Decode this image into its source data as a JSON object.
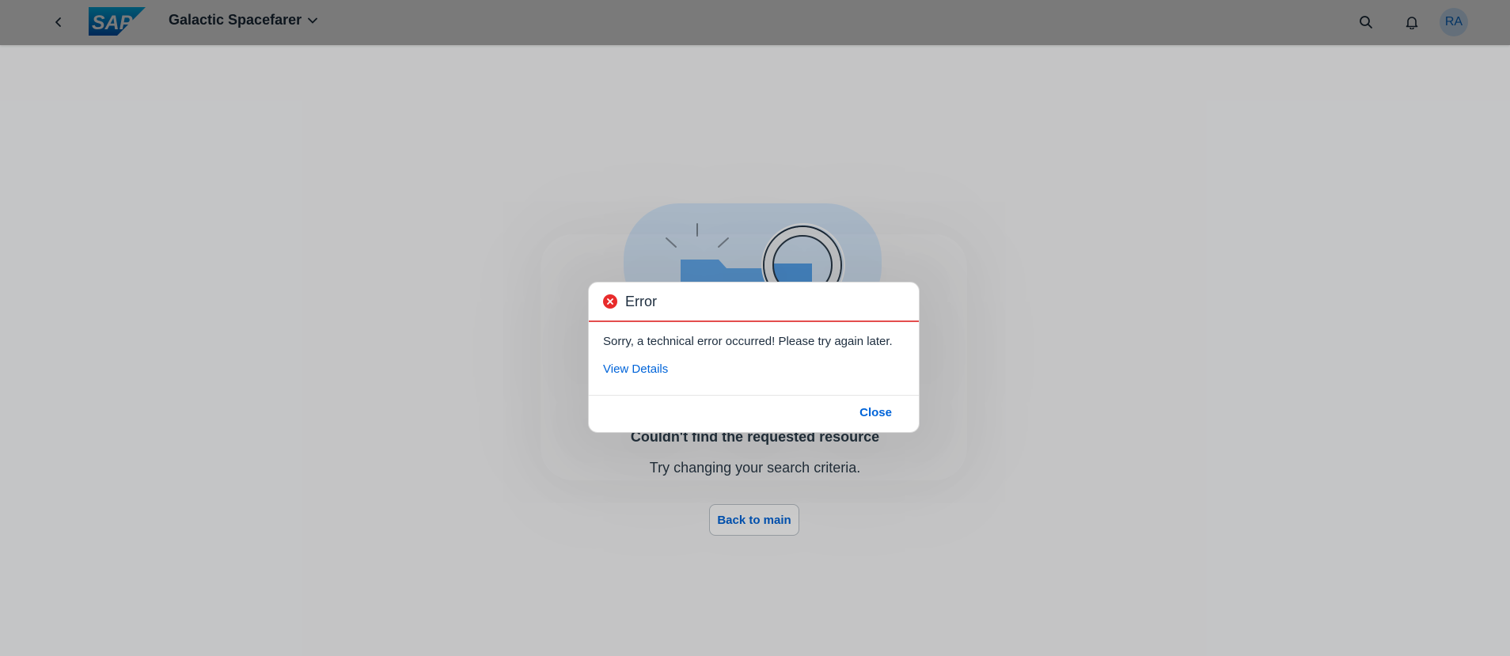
{
  "shell": {
    "logo_text": "SAP",
    "app_title": "Galactic Spacefarer",
    "avatar_initials": "RA",
    "icons": [
      "back-icon",
      "chevron-down-icon",
      "search-icon",
      "bell-icon"
    ]
  },
  "page": {
    "illustration": "folder-search-illustration",
    "title": "Couldn't find the requested resource",
    "subtitle": "Try changing your search criteria.",
    "back_button": "Back to main"
  },
  "dialog": {
    "title": "Error",
    "message": "Sorry, a technical error occurred! Please try again later.",
    "details_link": "View Details",
    "close_button": "Close",
    "icon": "error-icon"
  },
  "colors": {
    "accent": "#0064d9",
    "error": "#e82b2b",
    "text": "#1d2d3e"
  }
}
